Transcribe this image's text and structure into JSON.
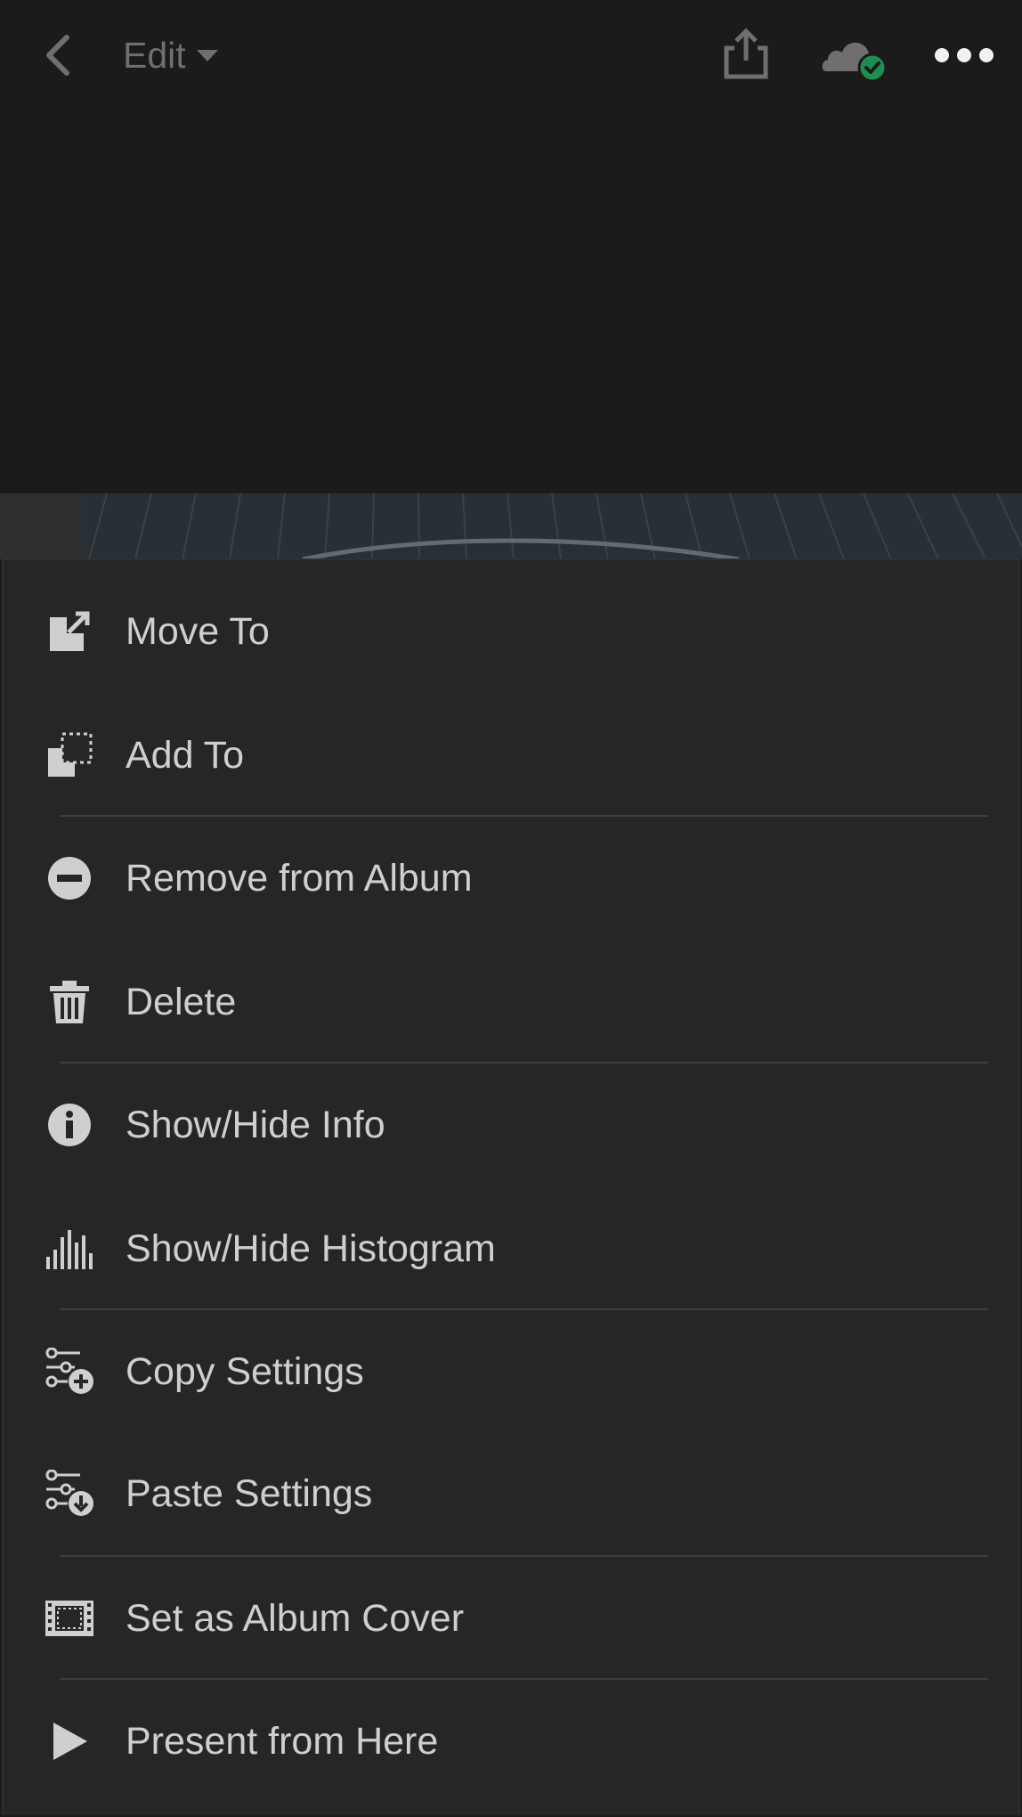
{
  "header": {
    "edit_label": "Edit",
    "icons": {
      "back": "chevron-left-icon",
      "mode_dropdown": "caret-down-icon",
      "share": "share-icon",
      "cloud": "cloud-synced-icon",
      "more": "more-horizontal-icon"
    }
  },
  "colors": {
    "background": "#1b1b1b",
    "sheet": "#262626",
    "text": "#cfcfcf",
    "icon": "#cfcfcf",
    "sync_badge": "#1e8e4f",
    "divider": "#3e3e3e"
  },
  "menu": {
    "items": [
      {
        "label": "Move To",
        "icon": "move-to-icon"
      },
      {
        "label": "Add To",
        "icon": "add-to-icon"
      },
      {
        "label": "Remove from Album",
        "icon": "remove-circle-icon"
      },
      {
        "label": "Delete",
        "icon": "trash-icon"
      },
      {
        "label": "Show/Hide Info",
        "icon": "info-icon"
      },
      {
        "label": "Show/Hide Histogram",
        "icon": "histogram-icon"
      },
      {
        "label": "Copy Settings",
        "icon": "copy-settings-icon"
      },
      {
        "label": "Paste Settings",
        "icon": "paste-settings-icon"
      },
      {
        "label": "Set as Album Cover",
        "icon": "album-cover-icon"
      },
      {
        "label": "Present from Here",
        "icon": "play-icon"
      }
    ]
  }
}
